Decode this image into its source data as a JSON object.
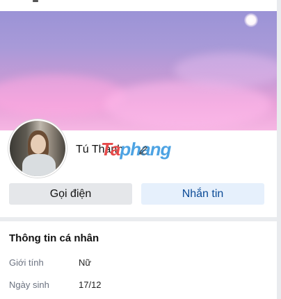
{
  "profile": {
    "name": "Tú Thanh",
    "watermark": {
      "part1": "Ta",
      "part2": "phang"
    }
  },
  "actions": {
    "call_label": "Gọi điện",
    "message_label": "Nhắn tin"
  },
  "info": {
    "title": "Thông tin cá nhân",
    "rows": [
      {
        "label": "Giới tính",
        "value": "Nữ"
      },
      {
        "label": "Ngày sinh",
        "value": "17/12"
      }
    ]
  }
}
